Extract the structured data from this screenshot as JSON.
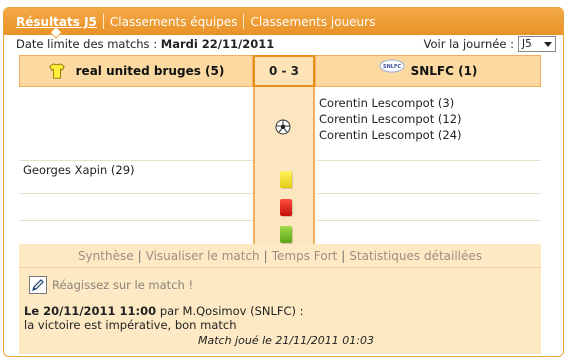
{
  "tabs": [
    {
      "label": "Résultats J5",
      "active": true
    },
    {
      "label": "Classements équipes",
      "active": false
    },
    {
      "label": "Classements joueurs",
      "active": false
    }
  ],
  "deadline": {
    "label": "Date limite des matchs :",
    "value": "Mardi 22/11/2011"
  },
  "round": {
    "label": "Voir la journée :",
    "selected": "J5"
  },
  "match": {
    "home_team": "real united bruges (5)",
    "away_team": "SNLFC (1)",
    "score": "0 - 3",
    "away_logo_text": "SNLFC",
    "goals": [
      "Corentin Lescompot (3)",
      "Corentin Lescompot (12)",
      "Corentin Lescompot (24)"
    ],
    "home_card_player": "Georges Xapin (29)"
  },
  "links": [
    "Synthèse",
    "Visualiser le match",
    "Temps Fort",
    "Statistiques détaillées"
  ],
  "react_label": "Réagissez sur le match !",
  "comment": {
    "timestamp": "Le 20/11/2011 11:00",
    "par": "par",
    "author": "M.Qosimov (SNLFC) :",
    "text": "la victoire est impérative, bon match"
  },
  "played_note": "Match joué le 21/11/2011 01:03",
  "colors": {
    "accent": "#ea9128",
    "panel": "#fde9c4"
  }
}
